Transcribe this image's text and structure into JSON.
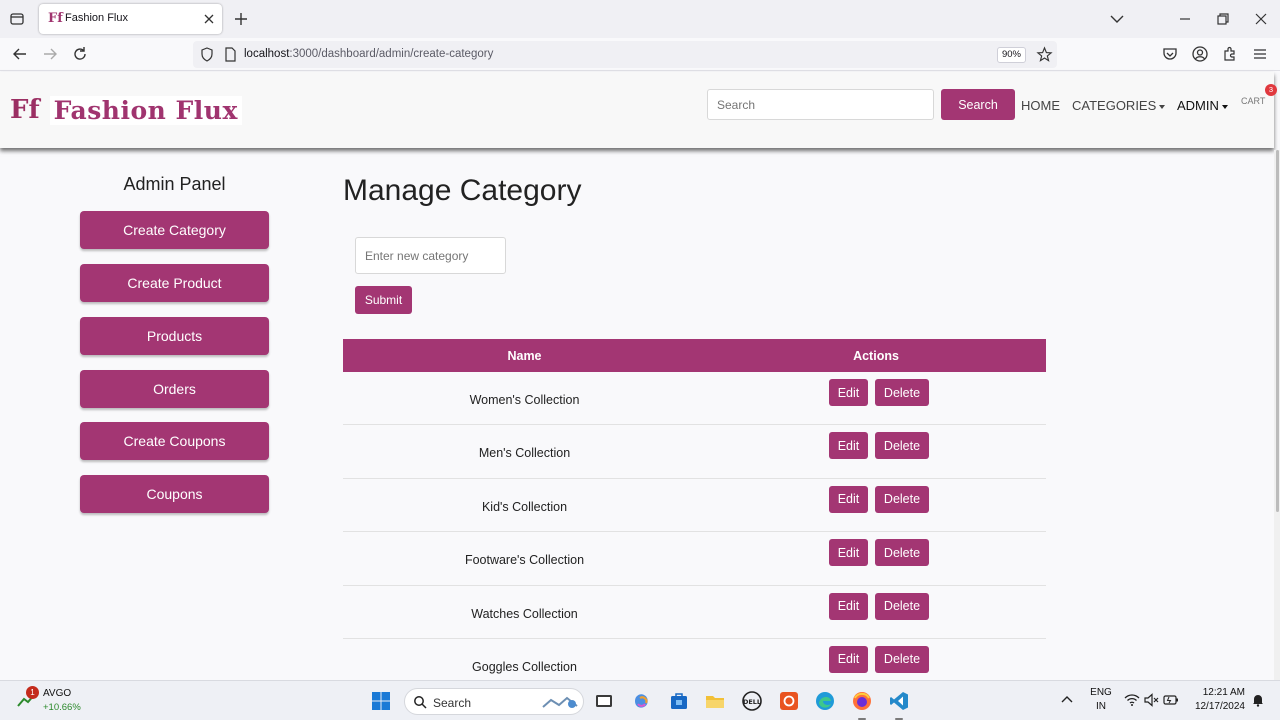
{
  "browser": {
    "tab_title": "Fashion Flux",
    "url_host": "localhost",
    "url_rest": ":3000/dashboard/admin/create-category",
    "zoom": "90%"
  },
  "header": {
    "logo_mark": "Ff",
    "logo_text": "Fashion Flux",
    "search_placeholder": "Search",
    "search_button": "Search",
    "nav": {
      "home": "HOME",
      "categories": "CATEGORIES",
      "admin": "ADMIN",
      "cart": "CART",
      "cart_count": "3"
    }
  },
  "sidebar": {
    "title": "Admin Panel",
    "items": [
      {
        "label": "Create Category"
      },
      {
        "label": "Create Product"
      },
      {
        "label": "Products"
      },
      {
        "label": "Orders"
      },
      {
        "label": "Create Coupons"
      },
      {
        "label": "Coupons"
      }
    ]
  },
  "main": {
    "title": "Manage Category",
    "input_placeholder": "Enter new category",
    "submit_label": "Submit",
    "table": {
      "headers": {
        "name": "Name",
        "actions": "Actions"
      },
      "edit_label": "Edit",
      "delete_label": "Delete",
      "rows": [
        {
          "name": "Women's Collection"
        },
        {
          "name": "Men's Collection"
        },
        {
          "name": "Kid's Collection"
        },
        {
          "name": "Footware's Collection"
        },
        {
          "name": "Watches Collection"
        },
        {
          "name": "Goggles Collection"
        }
      ]
    }
  },
  "taskbar": {
    "stock_name": "AVGO",
    "stock_change": "+10.66%",
    "stock_badge": "1",
    "search_label": "Search",
    "lang_1": "ENG",
    "lang_2": "IN",
    "time": "12:21 AM",
    "date": "12/17/2024"
  },
  "colors": {
    "accent": "#a33673",
    "brand": "#a0346f"
  }
}
